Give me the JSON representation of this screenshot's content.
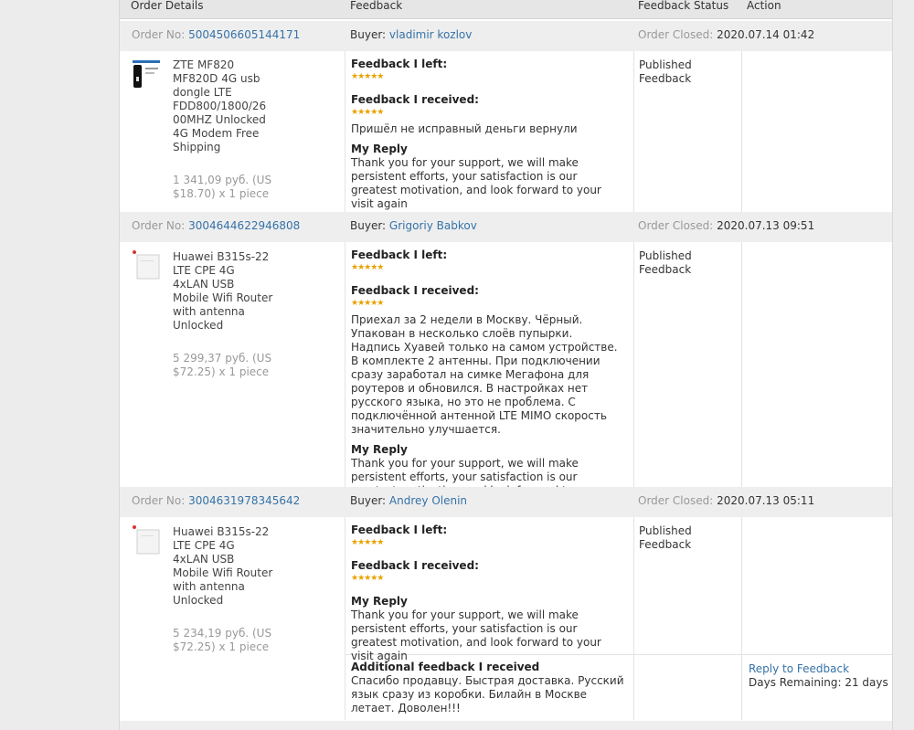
{
  "headers": {
    "order_details": "Order Details",
    "feedback": "Feedback",
    "feedback_status": "Feedback Status",
    "action": "Action"
  },
  "labels": {
    "order_no": "Order No:",
    "buyer": "Buyer:",
    "order_closed": "Order Closed:",
    "feedback_left": "Feedback I left:",
    "feedback_received": "Feedback I received:",
    "my_reply": "My Reply",
    "stars": "★★★★★",
    "reply_text": "Thank you for your support, we will make persistent efforts, your satisfaction is our greatest motivation, and look forward to your visit again",
    "additional": "Additional feedback I received",
    "reply_to_feedback": "Reply to Feedback",
    "days_remaining": "Days Remaining: 21 days"
  },
  "orders": [
    {
      "order_no": "5004506605144171",
      "buyer": "vladimir kozlov",
      "closed": "2020.07.14 01:42",
      "product": "ZTE MF820 MF820D 4G usb dongle LTE FDD800/1800/26 00MHZ Unlocked 4G Modem Free Shipping",
      "price": "1 341,09 руб. (US $18.70) x 1 piece",
      "received_text": "Пришёл не исправный деньги вернули",
      "status": "Published Feedback"
    },
    {
      "order_no": "3004644622946808",
      "buyer": "Grigoriy Babkov",
      "closed": "2020.07.13 09:51",
      "product": "Huawei B315s-22 LTE CPE 4G 4xLAN USB Mobile Wifi Router with antenna Unlocked",
      "price": "5 299,37 руб. (US $72.25) x 1 piece",
      "received_text": "Приехал за 2 недели в Москву. Чёрный. Упакован в несколько слоёв пупырки. Надпись Хуавей только на самом устройстве. В комплекте 2 антенны. При подключении сразу заработал на симке Мегафона для роутеров и обновился. В настройках нет русского языка, но это не проблема. С подключённой антенной LTE MIMO скорость значительно улучшается.",
      "status": "Published Feedback"
    },
    {
      "order_no": "3004631978345642",
      "buyer": "Andrey Olenin",
      "closed": "2020.07.13 05:11",
      "product": "Huawei B315s-22 LTE CPE 4G 4xLAN USB Mobile Wifi Router with antenna Unlocked",
      "price": "5 234,19 руб. (US $72.25) x 1 piece",
      "additional_text": "Спасибо продавцу. Быстрая доставка. Русский язык сразу из коробки. Билайн в Москве летает. Доволен!!!",
      "status": "Published Feedback"
    }
  ]
}
